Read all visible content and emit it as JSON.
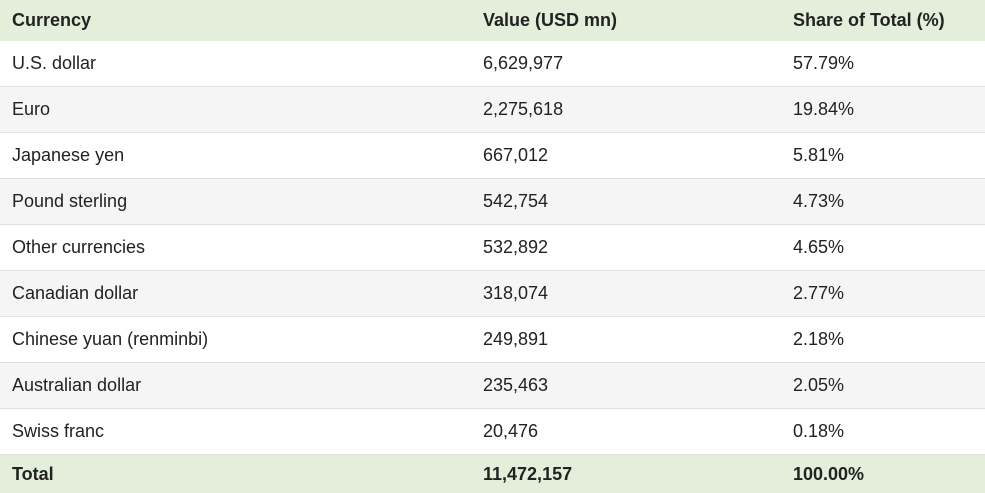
{
  "colors": {
    "header_bg": "#e3eedb",
    "total_bg": "#e3eedb",
    "alt_row_bg": "#f5f5f5",
    "row_bg": "#ffffff"
  },
  "chart_data": {
    "type": "table",
    "columns": [
      "Currency",
      "Value (USD mn)",
      "Share of Total (%)"
    ],
    "rows": [
      [
        "U.S. dollar",
        "6,629,977",
        "57.79%"
      ],
      [
        "Euro",
        "2,275,618",
        "19.84%"
      ],
      [
        "Japanese yen",
        "667,012",
        "5.81%"
      ],
      [
        "Pound sterling",
        "542,754",
        "4.73%"
      ],
      [
        "Other currencies",
        "532,892",
        "4.65%"
      ],
      [
        "Canadian dollar",
        "318,074",
        "2.77%"
      ],
      [
        "Chinese yuan (renminbi)",
        "249,891",
        "2.18%"
      ],
      [
        "Australian dollar",
        "235,463",
        "2.05%"
      ],
      [
        "Swiss franc",
        "20,476",
        "0.18%"
      ]
    ],
    "total": [
      "Total",
      "11,472,157",
      "100.00%"
    ]
  }
}
